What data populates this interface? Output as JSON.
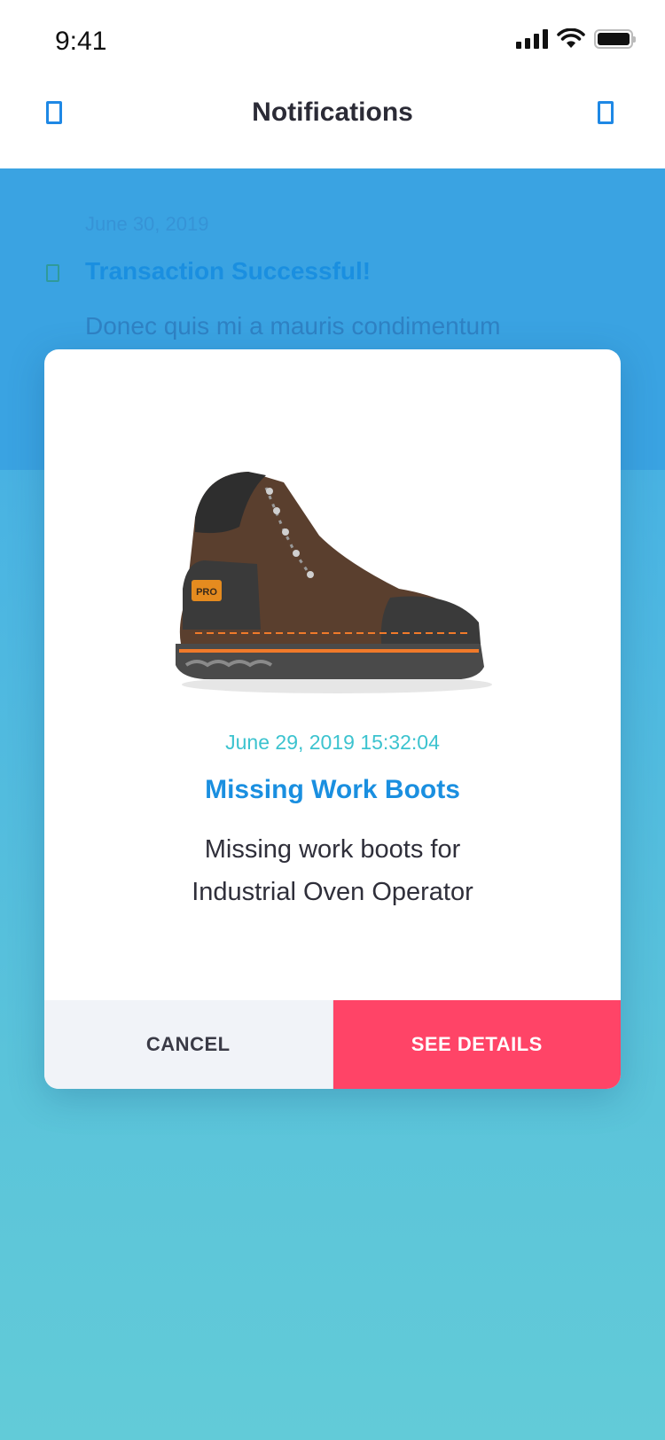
{
  "status_bar": {
    "time": "9:41"
  },
  "nav": {
    "title": "Notifications",
    "left_icon": "back-icon",
    "right_icon": "menu-icon"
  },
  "background_notification": {
    "date": "June 30, 2019",
    "title": "Transaction Successful!",
    "body": "Donec quis mi a mauris condimentum",
    "icon": "notification-icon"
  },
  "modal": {
    "image_name": "work-boot",
    "date": "June 29, 2019 15:32:04",
    "title": "Missing Work Boots",
    "body_line1": "Missing work boots for",
    "body_line2": "Industrial Oven Operator",
    "cancel_label": "CANCEL",
    "primary_label": "SEE DETAILS"
  },
  "colors": {
    "accent_blue": "#1a8fe0",
    "teal_date": "#3cc3cf",
    "primary_button": "#ff4467",
    "cancel_button": "#f1f3f8"
  }
}
